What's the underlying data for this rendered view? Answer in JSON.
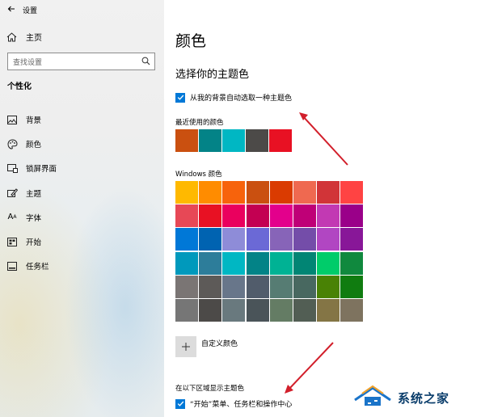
{
  "window": {
    "title": "设置"
  },
  "sidebar": {
    "home_label": "主页",
    "search_placeholder": "查找设置",
    "section_label": "个性化",
    "items": [
      {
        "label": "背景",
        "icon": "image-icon"
      },
      {
        "label": "颜色",
        "icon": "palette-icon"
      },
      {
        "label": "锁屏界面",
        "icon": "lock-screen-icon"
      },
      {
        "label": "主题",
        "icon": "theme-icon"
      },
      {
        "label": "字体",
        "icon": "font-icon"
      },
      {
        "label": "开始",
        "icon": "start-icon"
      },
      {
        "label": "任务栏",
        "icon": "taskbar-icon"
      }
    ]
  },
  "main": {
    "title": "颜色",
    "subtitle": "选择你的主题色",
    "auto_pick_label": "从我的背景自动选取一种主题色",
    "auto_pick_checked": true,
    "recent_label": "最近使用的颜色",
    "recent_colors": [
      "#ca5010",
      "#038387",
      "#00b7c3",
      "#4c4a48",
      "#e81123"
    ],
    "windows_colors_label": "Windows 颜色",
    "windows_colors": [
      "#ffb900",
      "#ff8c00",
      "#f7630c",
      "#ca5010",
      "#da3b01",
      "#ef6950",
      "#d13438",
      "#ff4343",
      "#e74856",
      "#e81123",
      "#ea005e",
      "#c30052",
      "#e3008c",
      "#bf0077",
      "#c239b3",
      "#9a0089",
      "#0078d7",
      "#0063b1",
      "#8e8cd8",
      "#6b69d6",
      "#8764b8",
      "#744da9",
      "#b146c2",
      "#881798",
      "#0099bc",
      "#2d7d9a",
      "#00b7c3",
      "#038387",
      "#00b294",
      "#018574",
      "#00cc6a",
      "#10893e",
      "#7a7574",
      "#5d5a58",
      "#68768a",
      "#515c6b",
      "#567c73",
      "#486860",
      "#498205",
      "#107c10",
      "#767676",
      "#4c4a48",
      "#69797e",
      "#4a5459",
      "#647c64",
      "#525e54",
      "#847545",
      "#7e735f"
    ],
    "custom_color_label": "自定义颜色",
    "show_on_label": "在以下区域显示主题色",
    "start_taskbar_label": "“开始”菜单、任务栏和操作中心",
    "start_taskbar_checked": true
  },
  "watermark": {
    "text": "系统之家"
  },
  "colors": {
    "accent": "#0078d7",
    "arrow": "#d21f2b"
  }
}
